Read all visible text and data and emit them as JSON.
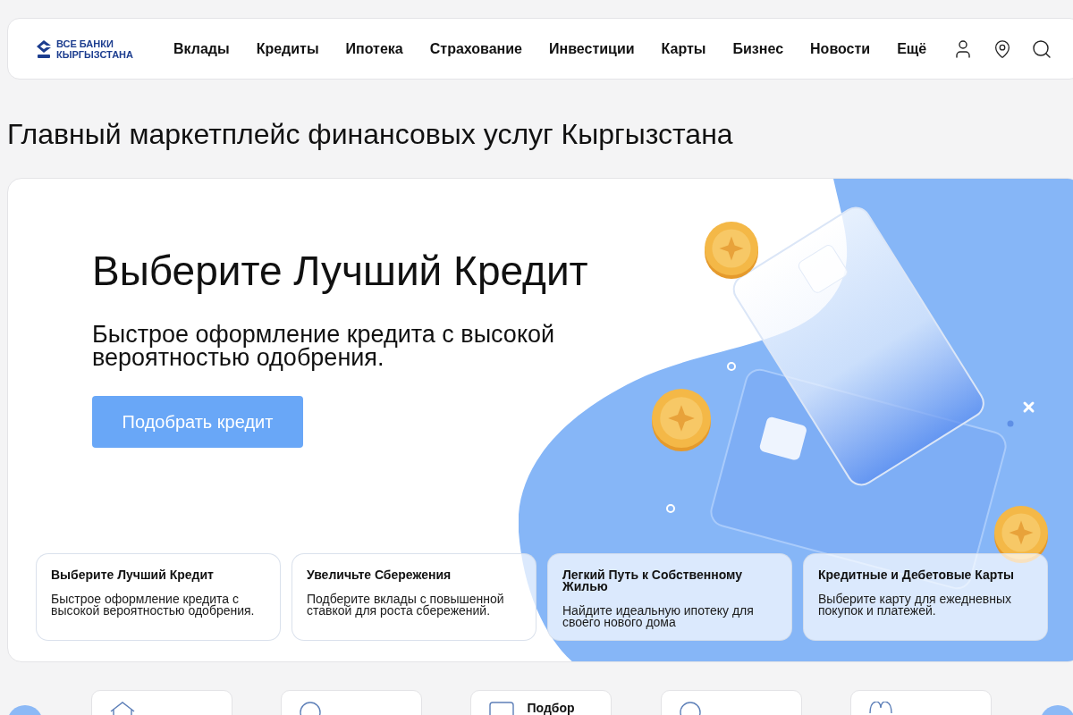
{
  "header": {
    "logo": {
      "line_1": "ВСЕ БАНКИ",
      "line_2": "КЫРГЫЗСТАНА"
    },
    "nav": [
      "Вклады",
      "Кредиты",
      "Ипотека",
      "Страхование",
      "Инвестиции",
      "Карты",
      "Бизнес",
      "Новости",
      "Ещё"
    ]
  },
  "page_title": "Главный маркетплейс финансовых услуг Кыргызстана",
  "hero": {
    "title": "Выберите Лучший Кредит",
    "subtitle": "Быстрое оформление кредита с высокой вероятностью одобрения.",
    "button": "Подобрать кредит"
  },
  "features": [
    {
      "title": "Выберите Лучший Кредит",
      "description": "Быстрое оформление кредита с высокой вероятностью одобрения."
    },
    {
      "title": "Увеличьте Сбережения",
      "description": "Подберите вклады с повышенной ставкой для роста сбережений."
    },
    {
      "title": "Легкий Путь к Собственному Жилью",
      "description": "Найдите идеальную ипотеку для своего нового дома"
    },
    {
      "title": "Кредитные и Дебетовые Карты",
      "description": "Выберите карту для ежедневных покупок и платежей."
    }
  ],
  "categories": [
    {
      "kind": "house"
    },
    {
      "kind": "arc"
    },
    {
      "kind": "card",
      "label": "Подбор"
    },
    {
      "kind": "arc"
    },
    {
      "kind": "loop"
    }
  ]
}
